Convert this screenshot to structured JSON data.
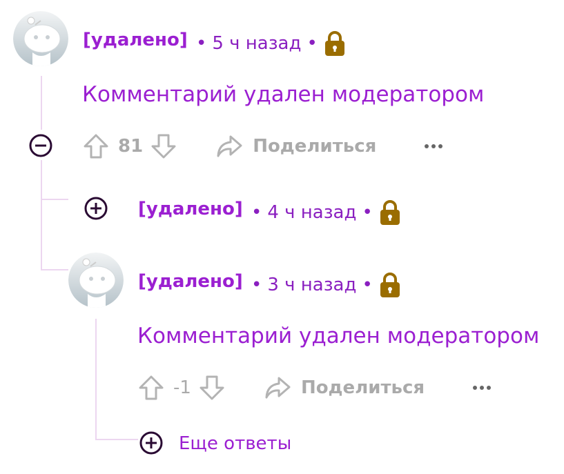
{
  "colors": {
    "accent": "#9b1fd1",
    "lock": "#9a6d00",
    "thread_line": "#ecd6f0",
    "muted": "#aaaaaa",
    "toggle_icon": "#2a0a33"
  },
  "comments": [
    {
      "author": "[удалено]",
      "age": "5 ч назад",
      "body": "Комментарий удален модератором",
      "votes": "81",
      "share_label": "Поделиться",
      "more_icon": "ellipsis-icon",
      "collapse_icon": "minus-circle-icon"
    },
    {
      "author": "[удалено]",
      "age": "4 ч назад",
      "collapsed": true,
      "expand_icon": "plus-circle-icon"
    },
    {
      "author": "[удалено]",
      "age": "3 ч назад",
      "body": "Комментарий удален модератором",
      "votes": "-1",
      "share_label": "Поделиться",
      "more_icon": "ellipsis-icon"
    }
  ],
  "more_replies": {
    "label": "Еще ответы",
    "icon": "plus-circle-icon"
  },
  "separator": "•"
}
